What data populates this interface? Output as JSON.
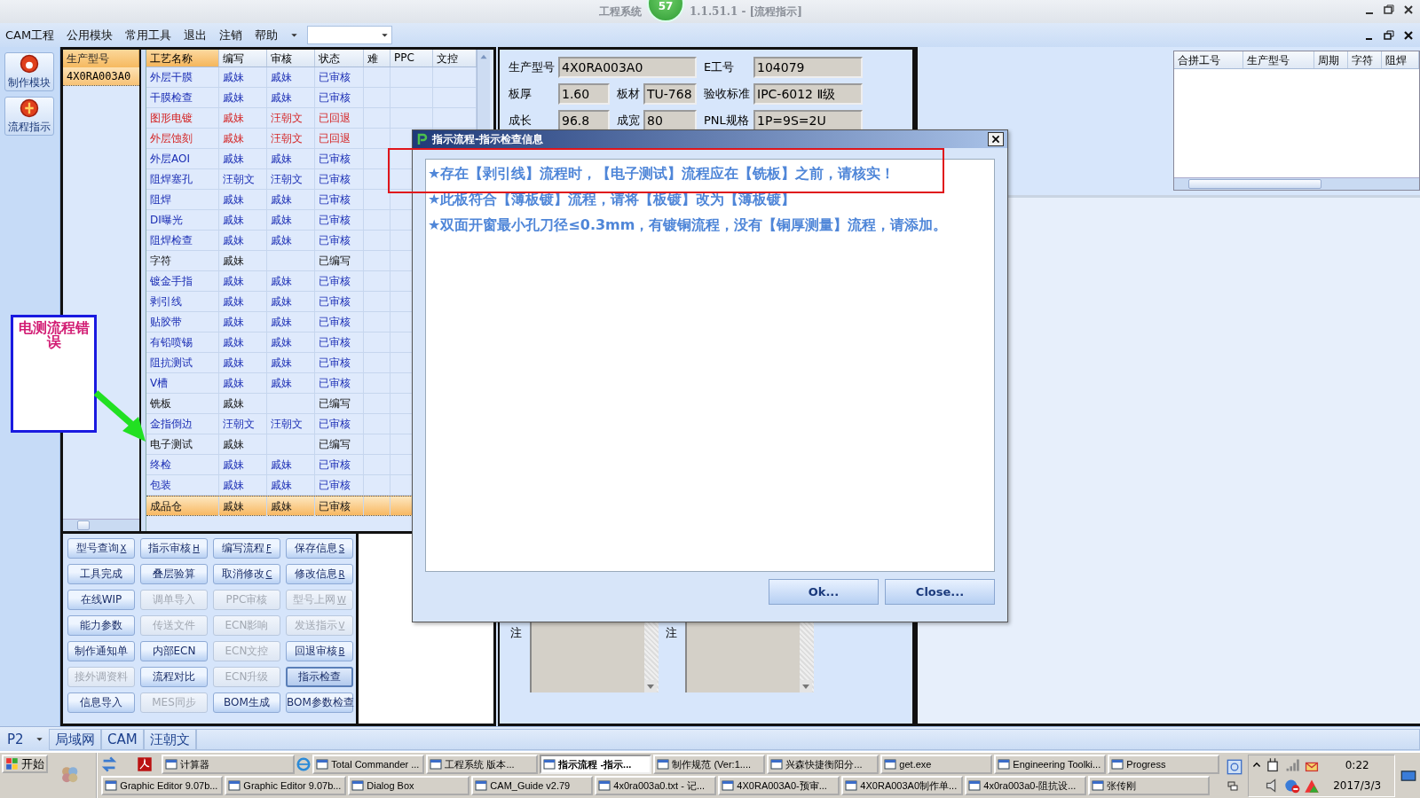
{
  "window": {
    "title_left": "工程系统",
    "badge": "57",
    "title_right": "1.1.51.1 - [流程指示]"
  },
  "menu": [
    "CAM工程",
    "公用模块",
    "常用工具",
    "退出",
    "注销",
    "帮助"
  ],
  "nav": [
    "制作模块",
    "流程指示"
  ],
  "model_list": {
    "header": "生产型号",
    "rows": [
      {
        "value": "4X0RA003A0",
        "selected": true
      }
    ]
  },
  "process_table": {
    "columns": [
      "工艺名称",
      "编写",
      "审核",
      "状态",
      "难",
      "PPC",
      "文控"
    ],
    "rows": [
      {
        "name": "外层干膜",
        "writer": "戚妹",
        "reviewer": "戚妹",
        "status": "已审核",
        "kind": "reviewed",
        "selected": false
      },
      {
        "name": "干膜检查",
        "writer": "戚妹",
        "reviewer": "戚妹",
        "status": "已审核",
        "kind": "reviewed",
        "selected": false
      },
      {
        "name": "图形电镀",
        "writer": "戚妹",
        "reviewer": "汪朝文",
        "status": "已回退",
        "kind": "returned",
        "selected": false
      },
      {
        "name": "外层蚀刻",
        "writer": "戚妹",
        "reviewer": "汪朝文",
        "status": "已回退",
        "kind": "returned",
        "selected": false
      },
      {
        "name": "外层AOI",
        "writer": "戚妹",
        "reviewer": "戚妹",
        "status": "已审核",
        "kind": "reviewed",
        "selected": false
      },
      {
        "name": "阻焊塞孔",
        "writer": "汪朝文",
        "reviewer": "汪朝文",
        "status": "已审核",
        "kind": "reviewed",
        "selected": false
      },
      {
        "name": "阻焊",
        "writer": "戚妹",
        "reviewer": "戚妹",
        "status": "已审核",
        "kind": "reviewed",
        "selected": false
      },
      {
        "name": "DI曝光",
        "writer": "戚妹",
        "reviewer": "戚妹",
        "status": "已审核",
        "kind": "reviewed",
        "selected": false
      },
      {
        "name": "阻焊检查",
        "writer": "戚妹",
        "reviewer": "戚妹",
        "status": "已审核",
        "kind": "reviewed",
        "selected": false
      },
      {
        "name": "字符",
        "writer": "戚妹",
        "status": "已编写",
        "kind": "written",
        "selected": false
      },
      {
        "name": "镀金手指",
        "writer": "戚妹",
        "reviewer": "戚妹",
        "status": "已审核",
        "kind": "reviewed",
        "selected": false
      },
      {
        "name": "剥引线",
        "writer": "戚妹",
        "reviewer": "戚妹",
        "status": "已审核",
        "kind": "reviewed",
        "selected": false
      },
      {
        "name": "贴胶带",
        "writer": "戚妹",
        "reviewer": "戚妹",
        "status": "已审核",
        "kind": "reviewed",
        "selected": false
      },
      {
        "name": "有铅喷锡",
        "writer": "戚妹",
        "reviewer": "戚妹",
        "status": "已审核",
        "kind": "reviewed",
        "selected": false
      },
      {
        "name": "阻抗测试",
        "writer": "戚妹",
        "reviewer": "戚妹",
        "status": "已审核",
        "kind": "reviewed",
        "selected": false
      },
      {
        "name": "V槽",
        "writer": "戚妹",
        "reviewer": "戚妹",
        "status": "已审核",
        "kind": "reviewed",
        "selected": false
      },
      {
        "name": "铣板",
        "writer": "戚妹",
        "status": "已编写",
        "kind": "written",
        "selected": false
      },
      {
        "name": "金指倒边",
        "writer": "汪朝文",
        "reviewer": "汪朝文",
        "status": "已审核",
        "kind": "reviewed",
        "selected": false
      },
      {
        "name": "电子测试",
        "writer": "戚妹",
        "status": "已编写",
        "kind": "written",
        "selected": false
      },
      {
        "name": "终检",
        "writer": "戚妹",
        "reviewer": "戚妹",
        "status": "已审核",
        "kind": "reviewed",
        "selected": false
      },
      {
        "name": "包装",
        "writer": "戚妹",
        "reviewer": "戚妹",
        "status": "已审核",
        "kind": "reviewed",
        "selected": false
      },
      {
        "name": "成品仓",
        "writer": "戚妹",
        "reviewer": "戚妹",
        "status": "已审核",
        "kind": "reviewed",
        "selected": true
      }
    ]
  },
  "action_buttons": [
    {
      "label": "型号查询",
      "hotkey": "X",
      "disabled": false,
      "focused": false
    },
    {
      "label": "指示审核",
      "hotkey": "H",
      "disabled": false,
      "focused": false
    },
    {
      "label": "编写流程",
      "hotkey": "F",
      "disabled": false,
      "focused": false
    },
    {
      "label": "保存信息",
      "hotkey": "S",
      "disabled": false,
      "focused": false
    },
    {
      "label": "工具完成",
      "disabled": false,
      "focused": false
    },
    {
      "label": "叠层验算",
      "disabled": false,
      "focused": false
    },
    {
      "label": "取消修改",
      "hotkey": "C",
      "disabled": false,
      "focused": false
    },
    {
      "label": "修改信息",
      "hotkey": "R",
      "disabled": false,
      "focused": false
    },
    {
      "label": "在线WIP",
      "disabled": false,
      "focused": false
    },
    {
      "label": "调单导入",
      "disabled": true,
      "focused": false
    },
    {
      "label": "PPC审核",
      "disabled": true,
      "focused": false
    },
    {
      "label": "型号上网",
      "hotkey": "W",
      "disabled": true,
      "focused": false
    },
    {
      "label": "能力参数",
      "disabled": false,
      "focused": false
    },
    {
      "label": "传送文件",
      "disabled": true,
      "focused": false
    },
    {
      "label": "ECN影响",
      "disabled": true,
      "focused": false
    },
    {
      "label": "发送指示",
      "hotkey": "V",
      "disabled": true,
      "focused": false
    },
    {
      "label": "制作通知单",
      "disabled": false,
      "focused": false
    },
    {
      "label": "内部ECN",
      "disabled": false,
      "focused": false
    },
    {
      "label": "ECN文控",
      "disabled": true,
      "focused": false
    },
    {
      "label": "回退审核",
      "hotkey": "B",
      "disabled": false,
      "focused": false
    },
    {
      "label": "接外调资料",
      "disabled": true,
      "focused": false
    },
    {
      "label": "流程对比",
      "disabled": false,
      "focused": false
    },
    {
      "label": "ECN升级",
      "disabled": true,
      "focused": false
    },
    {
      "label": "指示检查",
      "disabled": false,
      "focused": true
    },
    {
      "label": "信息导入",
      "disabled": false,
      "focused": false
    },
    {
      "label": "MES同步",
      "disabled": true,
      "focused": false
    },
    {
      "label": "BOM生成",
      "disabled": false,
      "focused": false
    },
    {
      "label": "BOM参数检查",
      "disabled": false,
      "focused": false
    }
  ],
  "info": {
    "fields": [
      {
        "label": "生产型号",
        "value": "4X0RA003A0"
      },
      {
        "label": "E工号",
        "value": "104079"
      },
      {
        "label": "板厚",
        "value": "1.60"
      },
      {
        "label": "板材",
        "value": "TU-768"
      },
      {
        "label": "验收标准",
        "value": "IPC-6012 Ⅱ级"
      },
      {
        "label": "成长",
        "value": "96.8"
      },
      {
        "label": "成宽",
        "value": "80"
      },
      {
        "label": "PNL规格",
        "value": "1P=9S=2U"
      }
    ],
    "remarks": [
      "注",
      "注"
    ]
  },
  "merge_table": {
    "columns": [
      "合拼工号",
      "生产型号",
      "周期",
      "字符",
      "阻焊"
    ]
  },
  "dialog": {
    "title": "指示流程-指示检查信息",
    "messages": [
      "★存在【剥引线】流程时，【电子测试】流程应在【铣板】之前，请核实！",
      "★此板符合【薄板镀】流程，请将【板镀】改为【薄板镀】",
      "★双面开窗最小孔刀径≤0.3mm，有镀铜流程，没有【铜厚测量】流程，请添加。"
    ],
    "buttons": [
      "Ok...",
      "Close..."
    ]
  },
  "annotation": {
    "text": "电测流程错误"
  },
  "status_bar": {
    "page": "P2",
    "items": [
      "局域网",
      "CAM",
      "汪朝文"
    ]
  },
  "taskbar": {
    "start": "开始",
    "row1": [
      {
        "label": "计算器",
        "active": false
      },
      {
        "label": "Total Commander ...",
        "active": false
      },
      {
        "label": "工程系统  版本...",
        "active": false
      },
      {
        "label": "指示流程 -指示...",
        "active": true
      },
      {
        "label": "制作规范 (Ver:1....",
        "active": false
      },
      {
        "label": "兴森快捷衡阳分...",
        "active": false
      },
      {
        "label": "get.exe",
        "active": false
      },
      {
        "label": "Engineering Toolki...",
        "active": false
      },
      {
        "label": "Progress",
        "active": false
      }
    ],
    "row2": [
      {
        "label": "Graphic Editor 9.07b...",
        "active": false
      },
      {
        "label": "Graphic Editor 9.07b...",
        "active": false
      },
      {
        "label": "Dialog Box",
        "active": false
      },
      {
        "label": "CAM_Guide v2.79",
        "active": false
      },
      {
        "label": "4x0ra003a0.txt - 记...",
        "active": false
      },
      {
        "label": "4X0RA003A0-预审...",
        "active": false
      },
      {
        "label": "4X0RA003A0制作单...",
        "active": false
      },
      {
        "label": "4x0ra003a0-阻抗设...",
        "active": false
      },
      {
        "label": "张传刚",
        "active": false
      }
    ],
    "time": "0:22",
    "date": "2017/3/3"
  }
}
